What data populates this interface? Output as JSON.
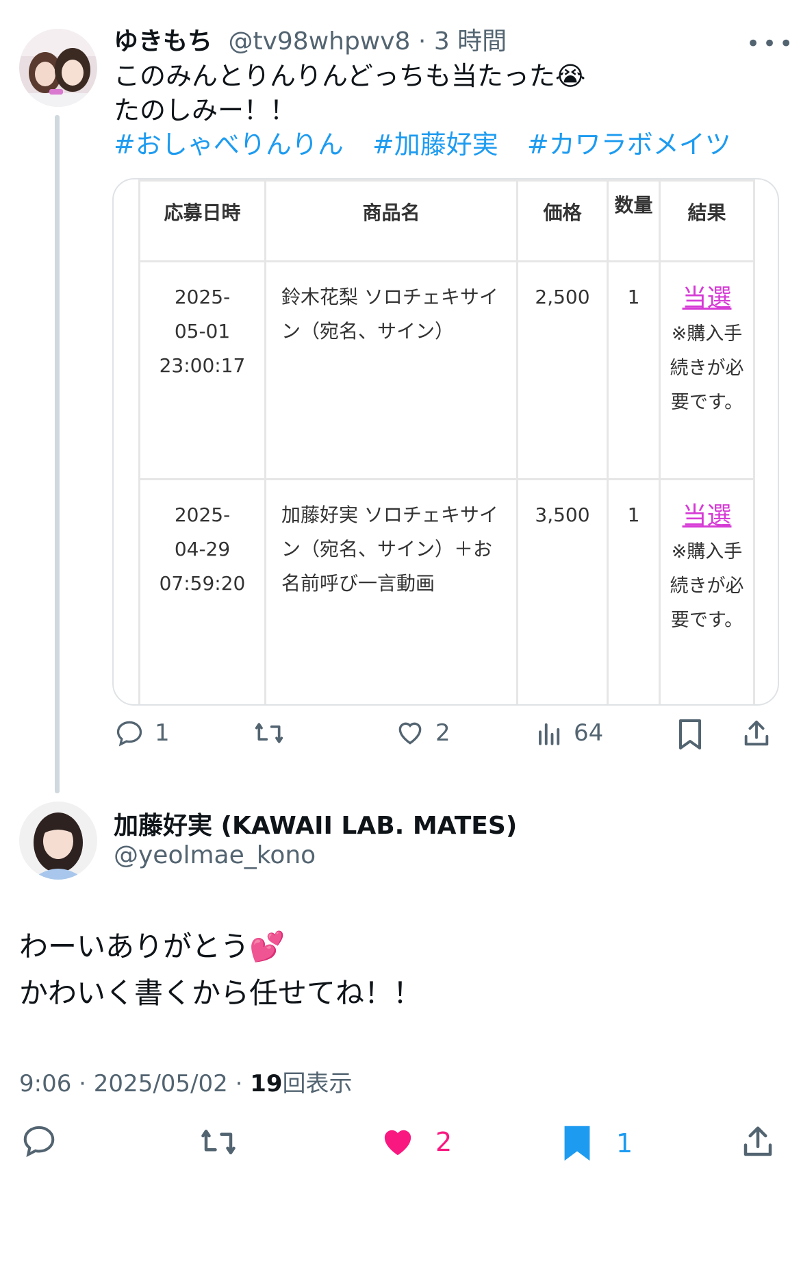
{
  "parent": {
    "display_name": "ゆきもち",
    "handle": "@tv98whpwv8",
    "separator": " · ",
    "time_ago": "3 時間",
    "more_label": "•••",
    "line1": "このみんとりんりんどっちも当たった",
    "line1_emoji": "😭",
    "line2": "たのしみー！！",
    "hashtags": [
      "#おしゃべりんりん",
      "#加藤好実",
      "#カワラボメイツ"
    ],
    "table": {
      "headers": [
        "応募日時",
        "商品名",
        "価格",
        "数量",
        "結果"
      ],
      "rows": [
        {
          "date": "2025-",
          "date2": "05-01",
          "time": "23:00:17",
          "product": "鈴木花梨 ソロチェキサイン（宛名、サイン）",
          "price": "2,500",
          "qty": "1",
          "result": "当選",
          "note": "※購入手続きが必要です。"
        },
        {
          "date": "2025-",
          "date2": "04-29",
          "time": "07:59:20",
          "product": "加藤好実 ソロチェキサイン（宛名、サイン）＋お名前呼び一言動画",
          "price": "3,500",
          "qty": "1",
          "result": "当選",
          "note": "※購入手続きが必要です。"
        }
      ]
    },
    "actions": {
      "replies": "1",
      "likes": "2",
      "views": "64"
    }
  },
  "reply": {
    "display_name": "加藤好実 (KAWAII LAB. MATES)",
    "handle": "@yeolmae_kono",
    "line1": "わーいありがとう",
    "line1_emoji": "💕",
    "line2": "かわいく書くから任せてね！！",
    "time": "9:06",
    "date": "2025/05/02",
    "sep": " · ",
    "views_count": "19",
    "views_label": "回表示",
    "actions": {
      "likes": "2",
      "bookmarks": "1"
    }
  },
  "colors": {
    "accent": "#1d9bf0",
    "like": "#f91880",
    "win": "#d63bd6",
    "muted": "#536471"
  }
}
